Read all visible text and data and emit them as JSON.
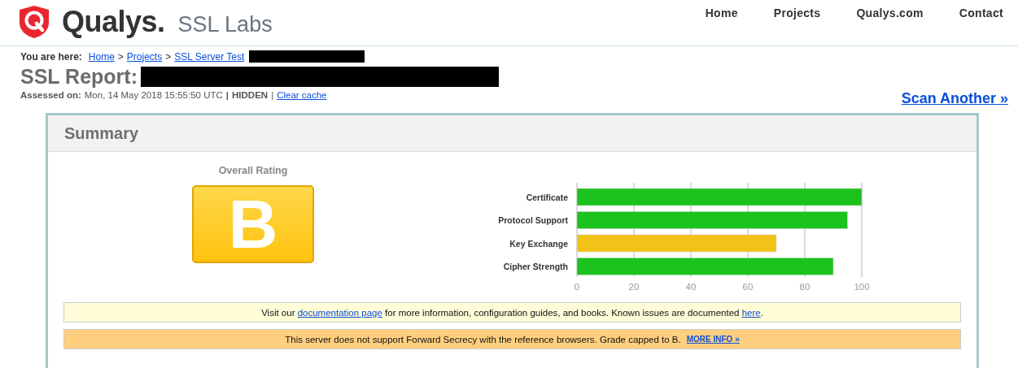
{
  "header": {
    "logo_text": "Qualys.",
    "logo_product": "SSL Labs",
    "nav": [
      "Home",
      "Projects",
      "Qualys.com",
      "Contact"
    ]
  },
  "breadcrumb": {
    "label": "You are here:",
    "links": [
      "Home",
      "Projects",
      "SSL Server Test"
    ],
    "separator": ">"
  },
  "report": {
    "title": "SSL Report:",
    "assessed_label": "Assessed on:",
    "assessed_value": "Mon, 14 May 2018 15:55:50 UTC",
    "separator": "|",
    "hidden": "HIDDEN",
    "clear_cache": "Clear cache",
    "scan_another": "Scan Another »"
  },
  "summary": {
    "title": "Summary",
    "rating_label": "Overall Rating",
    "grade": "B",
    "chart_data": {
      "type": "bar",
      "orientation": "horizontal",
      "grid": true,
      "categories": [
        "Certificate",
        "Protocol Support",
        "Key Exchange",
        "Cipher Strength"
      ],
      "values": [
        100,
        95,
        70,
        90
      ],
      "colors": [
        "#1cc21c",
        "#1cc21c",
        "#f2c218",
        "#1cc21c"
      ],
      "xlim": [
        0,
        100
      ],
      "xticks": [
        0,
        20,
        40,
        60,
        80,
        100
      ]
    },
    "notices": [
      {
        "kind": "info",
        "parts": [
          {
            "kind": "text",
            "text": "Visit our "
          },
          {
            "kind": "link",
            "text": "documentation page"
          },
          {
            "kind": "text",
            "text": " for more information, configuration guides, and books. Known issues are documented "
          },
          {
            "kind": "link",
            "text": "here"
          },
          {
            "kind": "text",
            "text": "."
          }
        ]
      },
      {
        "kind": "warning",
        "parts": [
          {
            "kind": "text",
            "text": "This server does not support Forward Secrecy with the reference browsers. Grade capped to B."
          },
          {
            "kind": "smalllink",
            "text": "MORE INFO »"
          }
        ]
      }
    ]
  }
}
